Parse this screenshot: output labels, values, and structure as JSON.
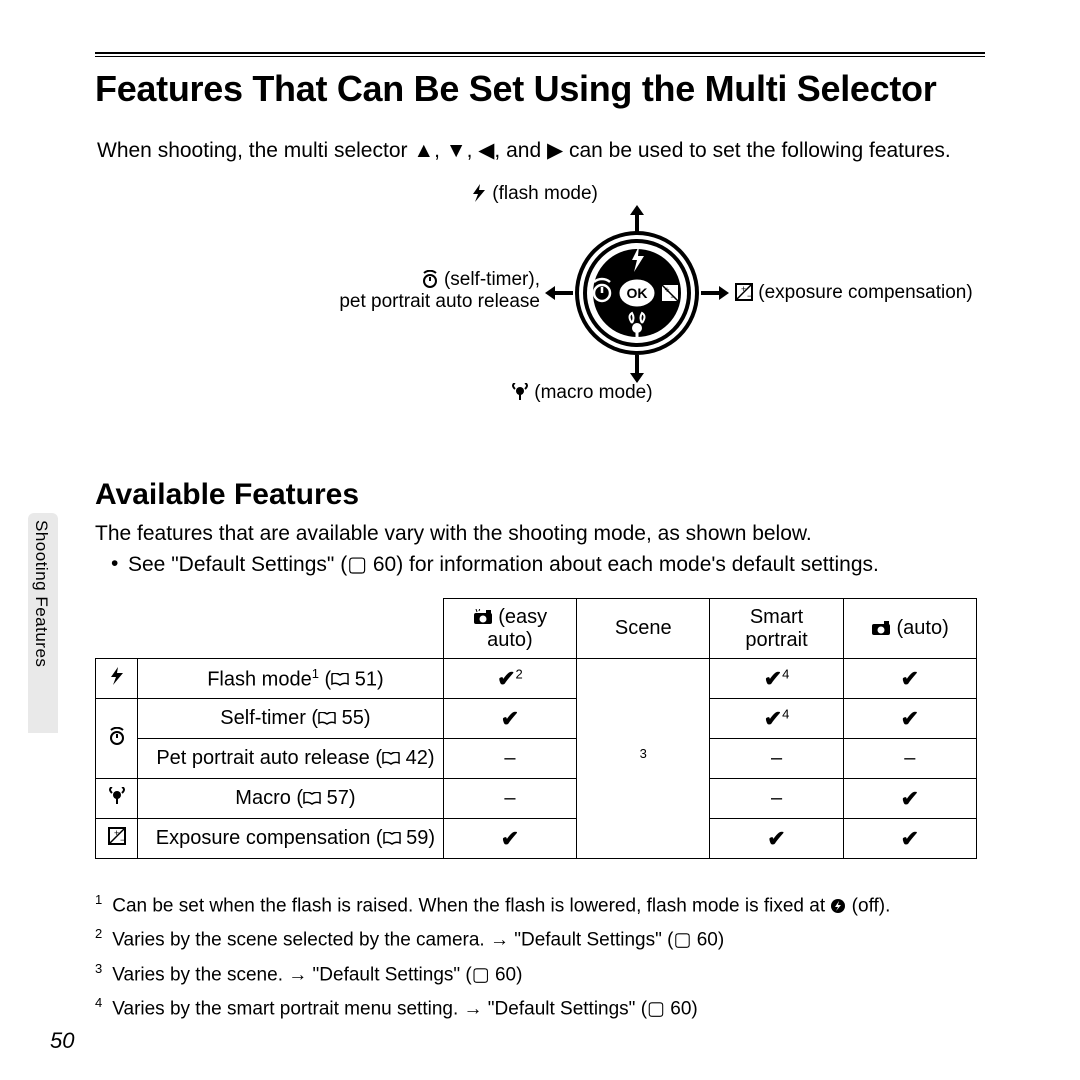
{
  "sidetab": "Shooting Features",
  "title": "Features That Can Be Set Using the Multi Selector",
  "intro_pre": "When shooting, the multi selector ",
  "intro_post": " can be used to set the following features.",
  "labels": {
    "up": "(flash mode)",
    "left_line1": "(self-timer),",
    "left_line2": "pet portrait auto release",
    "right": "(exposure compensation)",
    "down": "(macro mode)"
  },
  "h2": "Available Features",
  "para": "The features that are available vary with the shooting mode, as shown below.",
  "bullet": "See \"Default Settings\" (▢ 60) for information about each mode's default settings.",
  "headers": {
    "easy_top": "(easy",
    "easy_bot": "auto)",
    "scene": "Scene",
    "smart_top": "Smart",
    "smart_bot": "portrait",
    "auto": "(auto)"
  },
  "rows": [
    {
      "icon": "flash",
      "label": "Flash mode",
      "sup": "1",
      "ref": "51",
      "easy": "check2",
      "smart": "check4",
      "auto": "check"
    },
    {
      "icon": "timer",
      "label": "Self-timer",
      "sup": "",
      "ref": "55",
      "easy": "check",
      "smart": "check4",
      "auto": "check"
    },
    {
      "icon": "",
      "label": "Pet portrait auto release",
      "sup": "",
      "ref": "42",
      "easy": "dash",
      "smart": "dash",
      "auto": "dash"
    },
    {
      "icon": "macro",
      "label": "Macro",
      "sup": "",
      "ref": "57",
      "easy": "dash",
      "smart": "dash",
      "auto": "check"
    },
    {
      "icon": "expcomp",
      "label": "Exposure compensation",
      "sup": "",
      "ref": "59",
      "easy": "check",
      "smart": "check",
      "auto": "check"
    }
  ],
  "scene_note": "3",
  "footnotes": {
    "f1_a": "Can be set when the flash is raised. When the flash is lowered, flash mode is fixed at ",
    "f1_b": " (off).",
    "f2": "Varies by the scene selected by the camera. → \"Default Settings\" (▢ 60)",
    "f3": "Varies by the scene. → \"Default Settings\" (▢ 60)",
    "f4": "Varies by the smart portrait menu setting. → \"Default Settings\" (▢ 60)"
  },
  "pagenum": "50"
}
